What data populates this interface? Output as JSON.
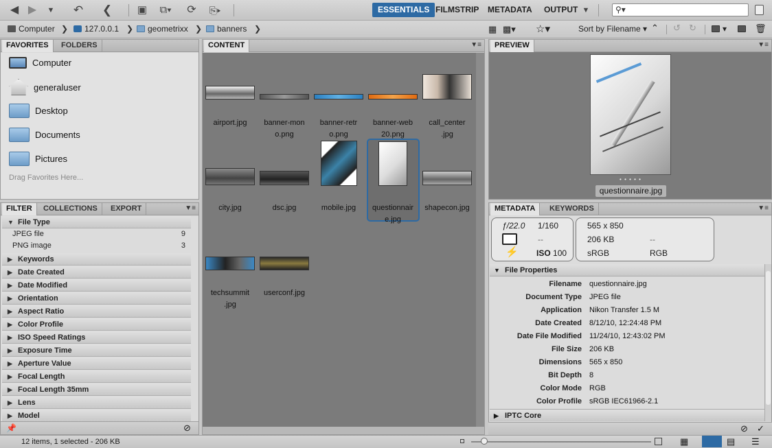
{
  "toolbar": {
    "workspaces": [
      "ESSENTIALS",
      "FILMSTRIP",
      "METADATA",
      "OUTPUT"
    ],
    "search_placeholder": "",
    "search_icon": "search-icon"
  },
  "path": {
    "crumbs": [
      "Computer",
      "127.0.0.1",
      "geometrixx",
      "banners"
    ],
    "sort_label": "Sort by Filename"
  },
  "favorites": {
    "tabs": [
      "FAVORITES",
      "FOLDERS"
    ],
    "items": [
      "Computer",
      "generaluser",
      "Desktop",
      "Documents",
      "Pictures"
    ],
    "hint": "Drag Favorites Here..."
  },
  "filter": {
    "tabs": [
      "FILTER",
      "COLLECTIONS",
      "EXPORT"
    ],
    "file_type_label": "File Type",
    "file_types": [
      {
        "name": "JPEG file",
        "count": "9"
      },
      {
        "name": "PNG image",
        "count": "3"
      }
    ],
    "categories": [
      "Keywords",
      "Date Created",
      "Date Modified",
      "Orientation",
      "Aspect Ratio",
      "Color Profile",
      "ISO Speed Ratings",
      "Exposure Time",
      "Aperture Value",
      "Focal Length",
      "Focal Length 35mm",
      "Lens",
      "Model"
    ]
  },
  "content": {
    "tab": "CONTENT",
    "items": [
      {
        "line1": "airport.jpg",
        "line2": ""
      },
      {
        "line1": "banner-mon",
        "line2": "o.png"
      },
      {
        "line1": "banner-retr",
        "line2": "o.png"
      },
      {
        "line1": "banner-web",
        "line2": "20.png"
      },
      {
        "line1": "call_center",
        "line2": ".jpg"
      },
      {
        "line1": "city.jpg",
        "line2": ""
      },
      {
        "line1": "dsc.jpg",
        "line2": ""
      },
      {
        "line1": "mobile.jpg",
        "line2": ""
      },
      {
        "line1": "questionnair",
        "line2": "e.jpg"
      },
      {
        "line1": "shapecon.jpg",
        "line2": ""
      },
      {
        "line1": "techsummit",
        "line2": ".jpg"
      },
      {
        "line1": "userconf.jpg",
        "line2": ""
      }
    ]
  },
  "preview": {
    "tab": "PREVIEW",
    "caption": "questionnaire.jpg",
    "dots": "• • • • •"
  },
  "metadata": {
    "tabs": [
      "METADATA",
      "KEYWORDS"
    ],
    "camera": {
      "aperture": "ƒ/22.0",
      "shutter": "1/160",
      "metering": "--",
      "iso": "100",
      "iso_label": "ISO"
    },
    "info": {
      "dimensions": "565 x 850",
      "size": "206 KB",
      "dash": "--",
      "profile": "sRGB",
      "mode": "RGB"
    },
    "section": "File Properties",
    "properties": [
      {
        "k": "Filename",
        "v": "questionnaire.jpg"
      },
      {
        "k": "Document Type",
        "v": "JPEG file"
      },
      {
        "k": "Application",
        "v": "Nikon Transfer 1.5 M"
      },
      {
        "k": "Date Created",
        "v": "8/12/10, 12:24:48 PM"
      },
      {
        "k": "Date File Modified",
        "v": "11/24/10, 12:43:02 PM"
      },
      {
        "k": "File Size",
        "v": "206 KB"
      },
      {
        "k": "Dimensions",
        "v": "565 x 850"
      },
      {
        "k": "Bit Depth",
        "v": "8"
      },
      {
        "k": "Color Mode",
        "v": "RGB"
      },
      {
        "k": "Color Profile",
        "v": "sRGB IEC61966-2.1"
      }
    ],
    "next_section": "IPTC Core"
  },
  "status": {
    "text": "12 items, 1 selected - 206 KB"
  },
  "colors": {
    "accent": "#2d6aa4",
    "content_bg": "#7b7b7b",
    "panel_bg": "#d9d9d9"
  }
}
